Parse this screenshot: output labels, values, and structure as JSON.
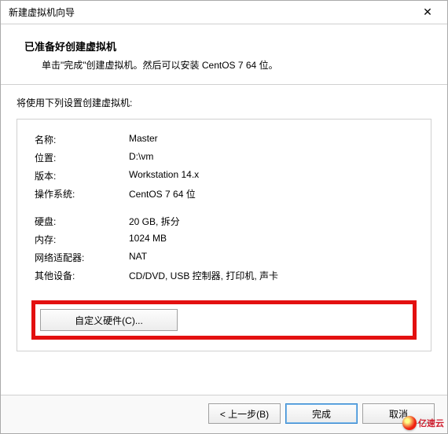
{
  "window": {
    "title": "新建虚拟机向导",
    "close": "✕"
  },
  "header": {
    "title": "已准备好创建虚拟机",
    "subtitle": "单击\"完成\"创建虚拟机。然后可以安装 CentOS 7 64 位。"
  },
  "settings_label": "将使用下列设置创建虚拟机:",
  "rows": [
    {
      "label": "名称:",
      "value": "Master"
    },
    {
      "label": "位置:",
      "value": "D:\\vm"
    },
    {
      "label": "版本:",
      "value": "Workstation 14.x"
    },
    {
      "label": "操作系统:",
      "value": "CentOS 7 64 位"
    }
  ],
  "rows2": [
    {
      "label": "硬盘:",
      "value": "20 GB, 拆分"
    },
    {
      "label": "内存:",
      "value": "1024 MB"
    },
    {
      "label": "网络适配器:",
      "value": "NAT"
    },
    {
      "label": "其他设备:",
      "value": "CD/DVD, USB 控制器, 打印机, 声卡"
    }
  ],
  "custom_hw_label": "自定义硬件(C)...",
  "footer": {
    "back": "< 上一步(B)",
    "finish": "完成",
    "cancel": "取消"
  },
  "watermark": "亿速云"
}
